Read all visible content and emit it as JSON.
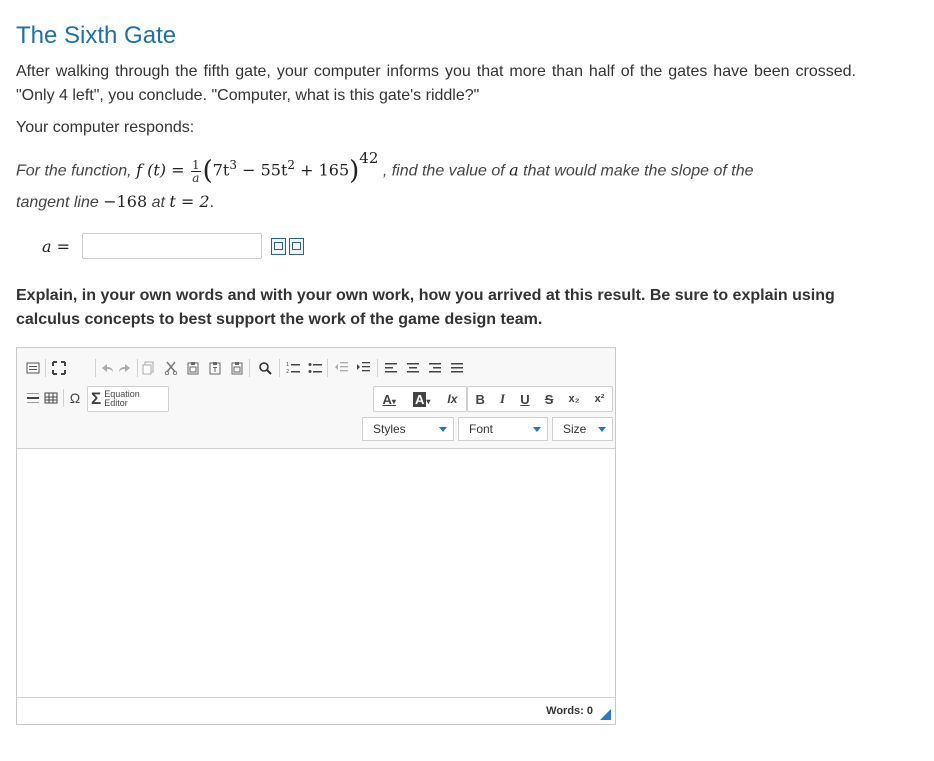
{
  "title": "The Sixth Gate",
  "intro": "After walking through the fifth gate, your computer informs you that more than half of the gates have been crossed. \"Only 4 left\", you conclude. \"Computer, what is this gate's riddle?\"",
  "responds": "Your computer responds:",
  "problem": {
    "lead": "For the function,",
    "fn": "f (t) =",
    "frac_num": "1",
    "frac_den": "a",
    "term1": "7t",
    "exp1": "3",
    "term2": " − 55t",
    "exp2": "2",
    "term3": " + 165",
    "outer_exp": "42",
    "mid": ", find the value of",
    "var_a": "a",
    "tail": "that would make the slope of the",
    "line2_lead": "tangent line",
    "slope_value": "−168",
    "at": "at",
    "t_eq": "t = 2",
    "period": "."
  },
  "answer": {
    "label": "a =",
    "value": "",
    "placeholder": ""
  },
  "explain": "Explain, in your own words and with your own work, how you arrived at this result. Be sure to explain using calculus concepts to best support the work of the game design team.",
  "editor": {
    "equation_line1": "Equation",
    "equation_line2": "Editor",
    "font_color_label": "A",
    "bg_color_label": "A",
    "remove_format": "Ix",
    "bold": "B",
    "italic": "I",
    "underline": "U",
    "strike": "S",
    "subscript": "x₂",
    "superscript": "x²",
    "omega": "Ω",
    "sigma": "Σ",
    "styles_label": "Styles",
    "font_label": "Font",
    "size_label": "Size",
    "words_label": "Words: 0",
    "content": ""
  },
  "colors": {
    "title": "#1f6fa8",
    "accent": "#2c7bc0"
  }
}
